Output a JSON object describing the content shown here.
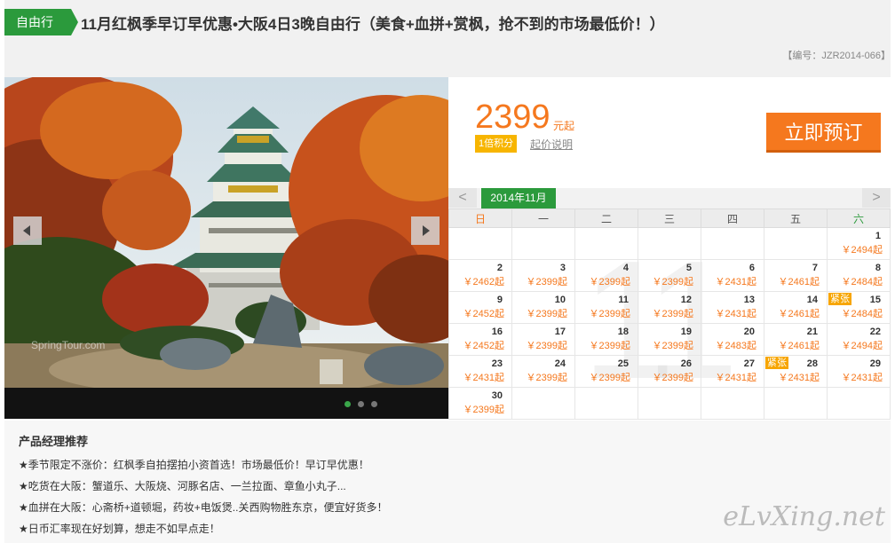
{
  "header": {
    "tag": "自由行",
    "title": "11月红枫季早订早优惠•大阪4日3晚自由行（美食+血拼+赏枫，抢不到的市场最低价！）",
    "code": "【编号：JZR2014-066】"
  },
  "photo": {
    "watermark": "SpringTour.com",
    "slides": 3,
    "active_slide": 1
  },
  "pricing": {
    "price": "2399",
    "unit": "元起",
    "points": "1倍积分",
    "note": "起价说明",
    "book_label": "立即预订"
  },
  "calendar": {
    "month_label": "2014年11月",
    "big_month": "11",
    "prev": "<",
    "next": ">",
    "weekdays": [
      "日",
      "一",
      "二",
      "三",
      "四",
      "五",
      "六"
    ],
    "weeks": [
      [
        null,
        null,
        null,
        null,
        null,
        null,
        {
          "day": "1",
          "price": "￥2494起"
        }
      ],
      [
        {
          "day": "2",
          "price": "￥2462起"
        },
        {
          "day": "3",
          "price": "￥2399起"
        },
        {
          "day": "4",
          "price": "￥2399起"
        },
        {
          "day": "5",
          "price": "￥2399起"
        },
        {
          "day": "6",
          "price": "￥2431起"
        },
        {
          "day": "7",
          "price": "￥2461起"
        },
        {
          "day": "8",
          "price": "￥2484起"
        }
      ],
      [
        {
          "day": "9",
          "price": "￥2452起"
        },
        {
          "day": "10",
          "price": "￥2399起"
        },
        {
          "day": "11",
          "price": "￥2399起"
        },
        {
          "day": "12",
          "price": "￥2399起"
        },
        {
          "day": "13",
          "price": "￥2431起"
        },
        {
          "day": "14",
          "price": "￥2461起"
        },
        {
          "day": "15",
          "price": "￥2484起",
          "tag": "紧张"
        }
      ],
      [
        {
          "day": "16",
          "price": "￥2452起"
        },
        {
          "day": "17",
          "price": "￥2399起"
        },
        {
          "day": "18",
          "price": "￥2399起"
        },
        {
          "day": "19",
          "price": "￥2399起"
        },
        {
          "day": "20",
          "price": "￥2483起"
        },
        {
          "day": "21",
          "price": "￥2461起"
        },
        {
          "day": "22",
          "price": "￥2494起"
        }
      ],
      [
        {
          "day": "23",
          "price": "￥2431起"
        },
        {
          "day": "24",
          "price": "￥2399起"
        },
        {
          "day": "25",
          "price": "￥2399起"
        },
        {
          "day": "26",
          "price": "￥2399起"
        },
        {
          "day": "27",
          "price": "￥2431起"
        },
        {
          "day": "28",
          "price": "￥2431起",
          "tag": "紧张"
        },
        {
          "day": "29",
          "price": "￥2431起"
        }
      ],
      [
        {
          "day": "30",
          "price": "￥2399起"
        },
        null,
        null,
        null,
        null,
        null,
        null
      ]
    ]
  },
  "recommend": {
    "title": "产品经理推荐",
    "items": [
      "★季节限定不涨价：红枫季自拍摆拍小资首选！市场最低价！早订早优惠！",
      "★吃货在大阪：蟹道乐、大阪烧、河豚名店、一兰拉面、章鱼小丸子...",
      "★血拼在大阪：心斋桥+道顿堀，药妆+电饭煲..关西购物胜东京，便宜好货多！",
      "★日币汇率现在好划算，想走不如早点走！"
    ]
  },
  "logo": "eLvXing.net",
  "colors": {
    "accent_green": "#2b9a3c",
    "accent_orange": "#f5781e"
  }
}
